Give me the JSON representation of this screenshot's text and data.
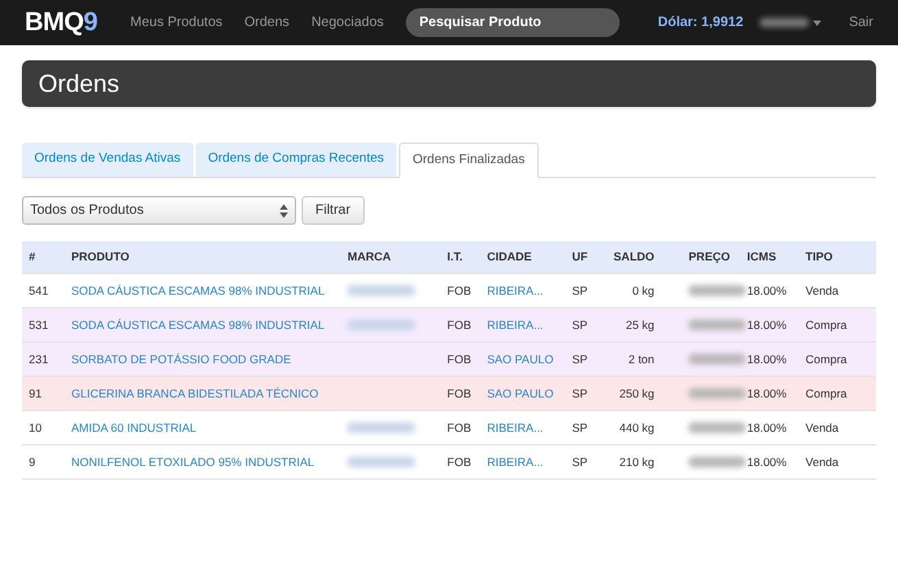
{
  "navbar": {
    "logo": "BMQ",
    "logo_accent": "9",
    "links": [
      "Meus Produtos",
      "Ordens",
      "Negociados"
    ],
    "search": {
      "placeholder": "Pesquisar Produto"
    },
    "dollar": "Dólar: 1,9912",
    "user_hidden": true,
    "logout": "Sair"
  },
  "page_title": "Ordens",
  "tabs": [
    {
      "label": "Ordens de Vendas Ativas",
      "selected": false
    },
    {
      "label": "Ordens de Compras Recentes",
      "selected": false
    },
    {
      "label": "Ordens Finalizadas",
      "selected": true
    }
  ],
  "filter": {
    "value": "Todos os Produtos",
    "button": "Filtrar"
  },
  "table": {
    "columns": [
      "#",
      "PRODUTO",
      "MARCA",
      "I.T.",
      "CIDADE",
      "UF",
      "SALDO",
      "PREÇO",
      "ICMS",
      "TIPO"
    ],
    "rows": [
      {
        "id": "541",
        "produto": "SODA CÁUSTICA ESCAMAS 98% INDUSTRIAL",
        "marca_hidden": true,
        "it": "FOB",
        "cidade": "RIBEIRA...",
        "uf": "SP",
        "saldo": "0 kg",
        "preco_hidden": true,
        "icms": "18.00%",
        "tipo": "Venda",
        "color": "#ffffff"
      },
      {
        "id": "531",
        "produto": "SODA CÁUSTICA ESCAMAS 98% INDUSTRIAL",
        "marca_hidden": true,
        "it": "FOB",
        "cidade": "RIBEIRA...",
        "uf": "SP",
        "saldo": "25 kg",
        "preco_hidden": true,
        "icms": "18.00%",
        "tipo": "Compra",
        "color": "#f6ebfd"
      },
      {
        "id": "231",
        "produto": "SORBATO DE POTÁSSIO FOOD GRADE",
        "marca_hidden": false,
        "it": "FOB",
        "cidade": "SAO PAULO",
        "uf": "SP",
        "saldo": "2 ton",
        "preco_hidden": true,
        "icms": "18.00%",
        "tipo": "Compra",
        "color": "#f6ebfd"
      },
      {
        "id": "91",
        "produto": "GLICERINA BRANCA BIDESTILADA TÉCNICO",
        "marca_hidden": false,
        "it": "FOB",
        "cidade": "SAO PAULO",
        "uf": "SP",
        "saldo": "250 kg",
        "preco_hidden": true,
        "icms": "18.00%",
        "tipo": "Compra",
        "color": "#fde6e8"
      },
      {
        "id": "10",
        "produto": "AMIDA 60 INDUSTRIAL",
        "marca_hidden": true,
        "it": "FOB",
        "cidade": "RIBEIRA...",
        "uf": "SP",
        "saldo": "440 kg",
        "preco_hidden": true,
        "icms": "18.00%",
        "tipo": "Venda",
        "color": "#ffffff"
      },
      {
        "id": "9",
        "produto": "NONILFENOL ETOXILADO 95% INDUSTRIAL",
        "marca_hidden": true,
        "it": "FOB",
        "cidade": "RIBEIRA...",
        "uf": "SP",
        "saldo": "210 kg",
        "preco_hidden": true,
        "icms": "18.00%",
        "tipo": "Venda",
        "color": "#ffffff"
      }
    ]
  }
}
